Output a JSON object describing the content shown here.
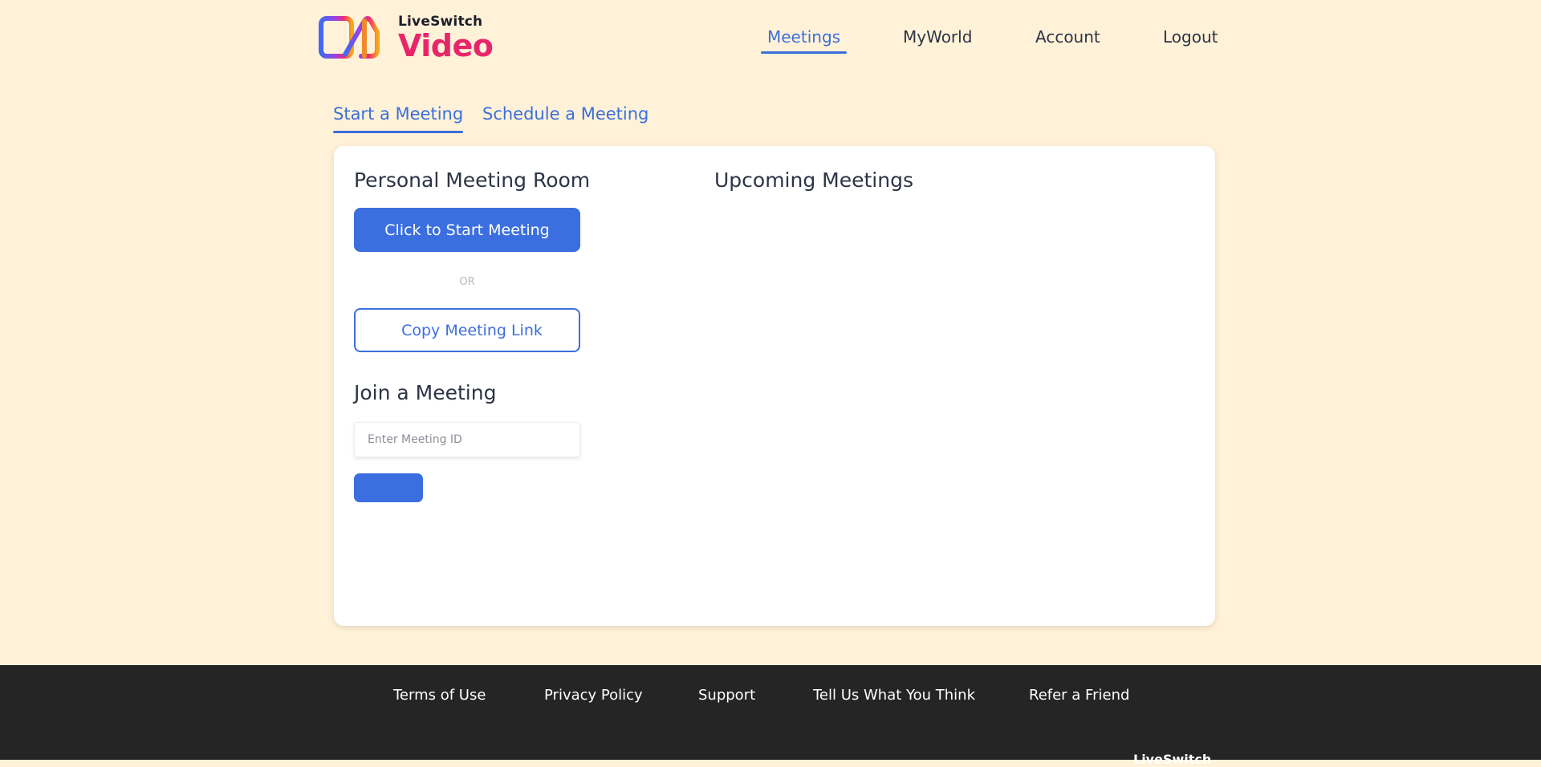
{
  "brand": {
    "name_small": "LiveSwitch",
    "name_big": "Video"
  },
  "nav": {
    "items": [
      {
        "label": "Meetings",
        "active": true
      },
      {
        "label": "MyWorld",
        "active": false
      },
      {
        "label": "Account",
        "active": false
      },
      {
        "label": "Logout",
        "active": false
      }
    ]
  },
  "tabs": [
    {
      "label": "Start a Meeting",
      "active": true
    },
    {
      "label": "Schedule a Meeting",
      "active": false
    }
  ],
  "personal_room": {
    "title": "Personal Meeting Room",
    "start_button": "Click to Start Meeting",
    "or_text": "OR",
    "copy_link_button": "Copy Meeting Link"
  },
  "join": {
    "title": "Join a Meeting",
    "placeholder": "Enter Meeting ID",
    "value": "",
    "button_label": ""
  },
  "upcoming": {
    "title": "Upcoming Meetings"
  },
  "footer": {
    "links": [
      "Terms of Use",
      "Privacy Policy",
      "Support",
      "Tell Us What You Think",
      "Refer a Friend"
    ],
    "brand_partial": "LiveSwitch"
  },
  "colors": {
    "page_bg": "#fff2d8",
    "accent": "#3b6fdc",
    "logo_pink": "#e8256a",
    "footer_bg": "#252525"
  }
}
